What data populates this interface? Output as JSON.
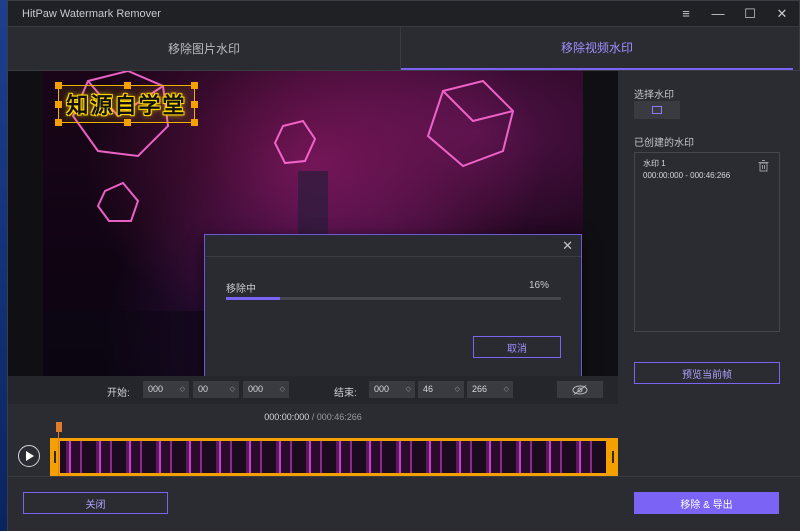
{
  "window": {
    "title": "HitPaw Watermark Remover",
    "controls": [
      "≡",
      "—",
      "☐",
      "✕"
    ]
  },
  "tabs": [
    {
      "label": "移除图片水印",
      "active": false
    },
    {
      "label": "移除视频水印",
      "active": true
    }
  ],
  "video": {
    "watermark_text": "知源自学堂"
  },
  "modal": {
    "status": "移除中",
    "percent_text": "16%",
    "progress": 0.16,
    "cancel_label": "取消",
    "close_glyph": "✕"
  },
  "right_panel": {
    "select_label": "选择水印",
    "created_label": "已创建的水印",
    "watermarks": [
      {
        "name": "水印 1",
        "time": "000:00:000 - 000:46:266"
      }
    ],
    "preview_label": "预览当前帧"
  },
  "time_controls": {
    "start_label": "开始:",
    "start": [
      "000",
      "00",
      "000"
    ],
    "end_label": "结束:",
    "end": [
      "000",
      "46",
      "266"
    ],
    "eye_icon": "eye-slash-icon"
  },
  "timeline": {
    "current": "000:00:000",
    "separator": " / ",
    "total": "000:46:266"
  },
  "footer": {
    "close_label": "关闭",
    "export_label": "移除 & 导出"
  },
  "colors": {
    "accent": "#7b63f5",
    "handle": "#f3a000",
    "background": "#2b2c31"
  }
}
